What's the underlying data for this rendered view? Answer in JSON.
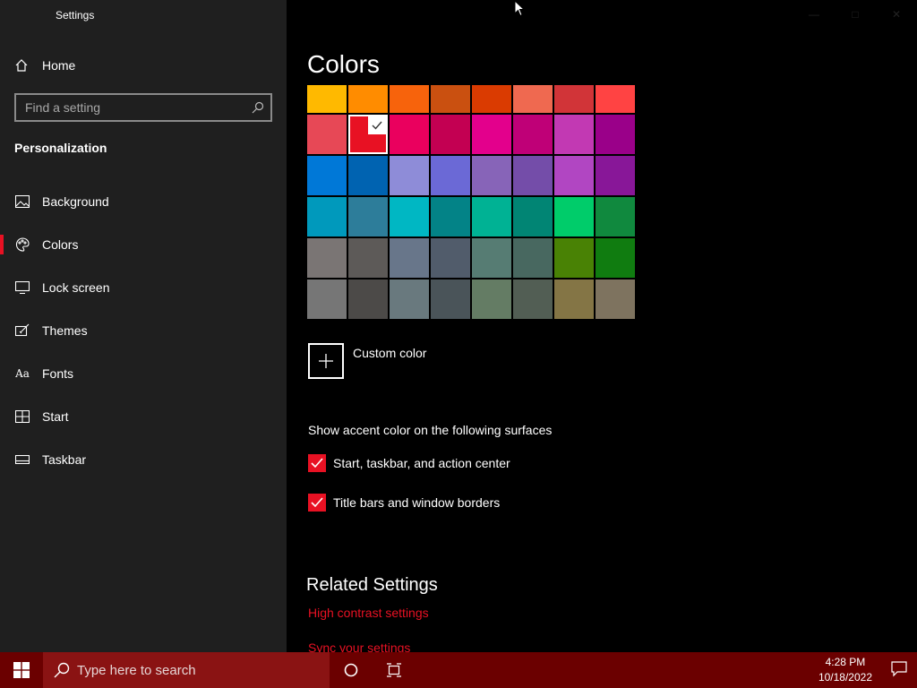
{
  "app": {
    "title": "Settings"
  },
  "sidebar": {
    "home_label": "Home",
    "search_placeholder": "Find a setting",
    "section": "Personalization",
    "items": [
      {
        "label": "Background",
        "icon": "image-icon"
      },
      {
        "label": "Colors",
        "icon": "palette-icon",
        "active": true
      },
      {
        "label": "Lock screen",
        "icon": "lock-screen-icon"
      },
      {
        "label": "Themes",
        "icon": "themes-icon"
      },
      {
        "label": "Fonts",
        "icon": "fonts-icon"
      },
      {
        "label": "Start",
        "icon": "start-icon"
      },
      {
        "label": "Taskbar",
        "icon": "taskbar-icon"
      }
    ]
  },
  "main": {
    "title": "Colors",
    "swatches": [
      [
        "#FFB900",
        "#FF8C00",
        "#F7630C",
        "#CA5010",
        "#DA3B01",
        "#EF6950",
        "#D13438",
        "#FF4343"
      ],
      [
        "#E74856",
        "#E81123",
        "#EA005E",
        "#C30052",
        "#E3008C",
        "#BF0077",
        "#C239B3",
        "#9A0089"
      ],
      [
        "#0078D7",
        "#0063B1",
        "#8E8CD8",
        "#6B69D6",
        "#8764B8",
        "#744DA9",
        "#B146C2",
        "#881798"
      ],
      [
        "#0099BC",
        "#2D7D9A",
        "#00B7C3",
        "#038387",
        "#00B294",
        "#018574",
        "#00CC6A",
        "#10893E"
      ],
      [
        "#7A7574",
        "#5D5A58",
        "#68768A",
        "#515C6B",
        "#567C73",
        "#486860",
        "#498205",
        "#107C10"
      ],
      [
        "#767676",
        "#4C4A48",
        "#69797E",
        "#4A5459",
        "#647C64",
        "#525E54",
        "#847545",
        "#7E735F"
      ]
    ],
    "selected_swatch": {
      "row": 1,
      "col": 1
    },
    "custom_color_label": "Custom color",
    "surfaces_label": "Show accent color on the following surfaces",
    "checkboxes": [
      {
        "label": "Start, taskbar, and action center",
        "checked": true
      },
      {
        "label": "Title bars and window borders",
        "checked": true
      }
    ],
    "related_title": "Related Settings",
    "links": [
      "High contrast settings",
      "Sync your settings"
    ]
  },
  "taskbar": {
    "search_placeholder": "Type here to search",
    "time": "4:28 PM",
    "date": "10/18/2022"
  },
  "colors": {
    "accent": "#E81123",
    "taskbar_bg": "#6B0000",
    "sidebar_bg": "#1F1F1F"
  }
}
